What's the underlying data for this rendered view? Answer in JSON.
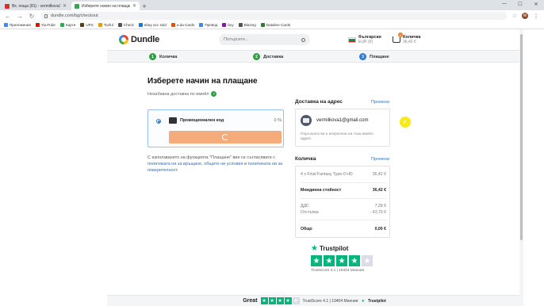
{
  "browser": {
    "tabs": [
      {
        "title": "Вх. поща (81) - vermilkova1@gm",
        "color": "#d93025",
        "active": false
      },
      {
        "title": "Изберете начин на плащане | D",
        "color": "#34a853",
        "active": true
      }
    ],
    "new_tab": "+",
    "url": "dundle.com/bg/checkout",
    "avatar_letter": "M",
    "bookmarks": [
      {
        "label": "Приложения",
        "color": "#4285f4"
      },
      {
        "label": "YouTube",
        "color": "#ff0000"
      },
      {
        "label": "Карти",
        "color": "#34a853"
      },
      {
        "label": "UPS",
        "color": "#5a3b1c"
      },
      {
        "label": "Tovful",
        "color": "#e0a100"
      },
      {
        "label": "Check",
        "color": "#555555"
      },
      {
        "label": "ebay acc sold",
        "color": "#1a73e8"
      },
      {
        "label": "a.da Cards",
        "color": "#e65100"
      },
      {
        "label": "Превод",
        "color": "#4285f4"
      },
      {
        "label": "buy",
        "color": "#7b1fa2"
      },
      {
        "label": "Blazing",
        "color": "#555555"
      },
      {
        "label": "Dataline Cards",
        "color": "#2e7d32"
      }
    ]
  },
  "header": {
    "logo": "Dundle",
    "search_placeholder": "Потърсете...",
    "language": "български",
    "currency": "EUR (€)",
    "cart_label": "Количка",
    "cart_total": "36,42 €",
    "cart_count": "1"
  },
  "steps": [
    {
      "num": "1",
      "label": "Количка",
      "state": "done"
    },
    {
      "num": "2",
      "label": "Доставка",
      "state": "done"
    },
    {
      "num": "3",
      "label": "Плащане",
      "state": "current"
    }
  ],
  "main": {
    "title": "Изберете начин на плащане",
    "delivery_note": "Незабавна доставка по имейл",
    "payment_method": "Промоционален код",
    "payment_fee": "0 %",
    "terms": {
      "part1": "С използването на функцията \"Плащане\" вие се съгласявате с ",
      "link1": "политиката ни за връщане",
      "part2": ", ",
      "link2": "общите ни условия",
      "part3": " и ",
      "link3": "политиката ни за поверителност",
      "part4": "."
    }
  },
  "sidebar": {
    "address_title": "Доставка на адрес",
    "address_edit": "Промени",
    "email": "vermilkova1@gmail.com",
    "address_note": "Поръчката ви е изпратена на този имейл адрес.",
    "cart_title": "Количка",
    "cart_edit": "Промени",
    "item_qty": "4",
    "item_name": "Final Fantasy Type-0 HD",
    "item_price": "36,42 €",
    "subtotal_label": "Междинна стойност",
    "subtotal": "36,42 €",
    "vat_label": "ДДС",
    "vat": "7,28 €",
    "discount_label": "Отстъпка",
    "discount": "- 43,70 €",
    "total_label": "Общо",
    "total": "0,00 €"
  },
  "trustpilot": {
    "brand": "Trustpilot",
    "score_text": "TrustScore 4.1 | 19404 Мнения",
    "rating": 4,
    "star_color": "#00b67a"
  },
  "footer": {
    "great": "Great",
    "score_text": "TrustScore 4.1 | 19404 Мнения",
    "brand": "Trustpilot"
  },
  "colors": {
    "accent_blue": "#2f7ad6",
    "success_green": "#2ea043",
    "pay_button": "#f5ab7a"
  }
}
